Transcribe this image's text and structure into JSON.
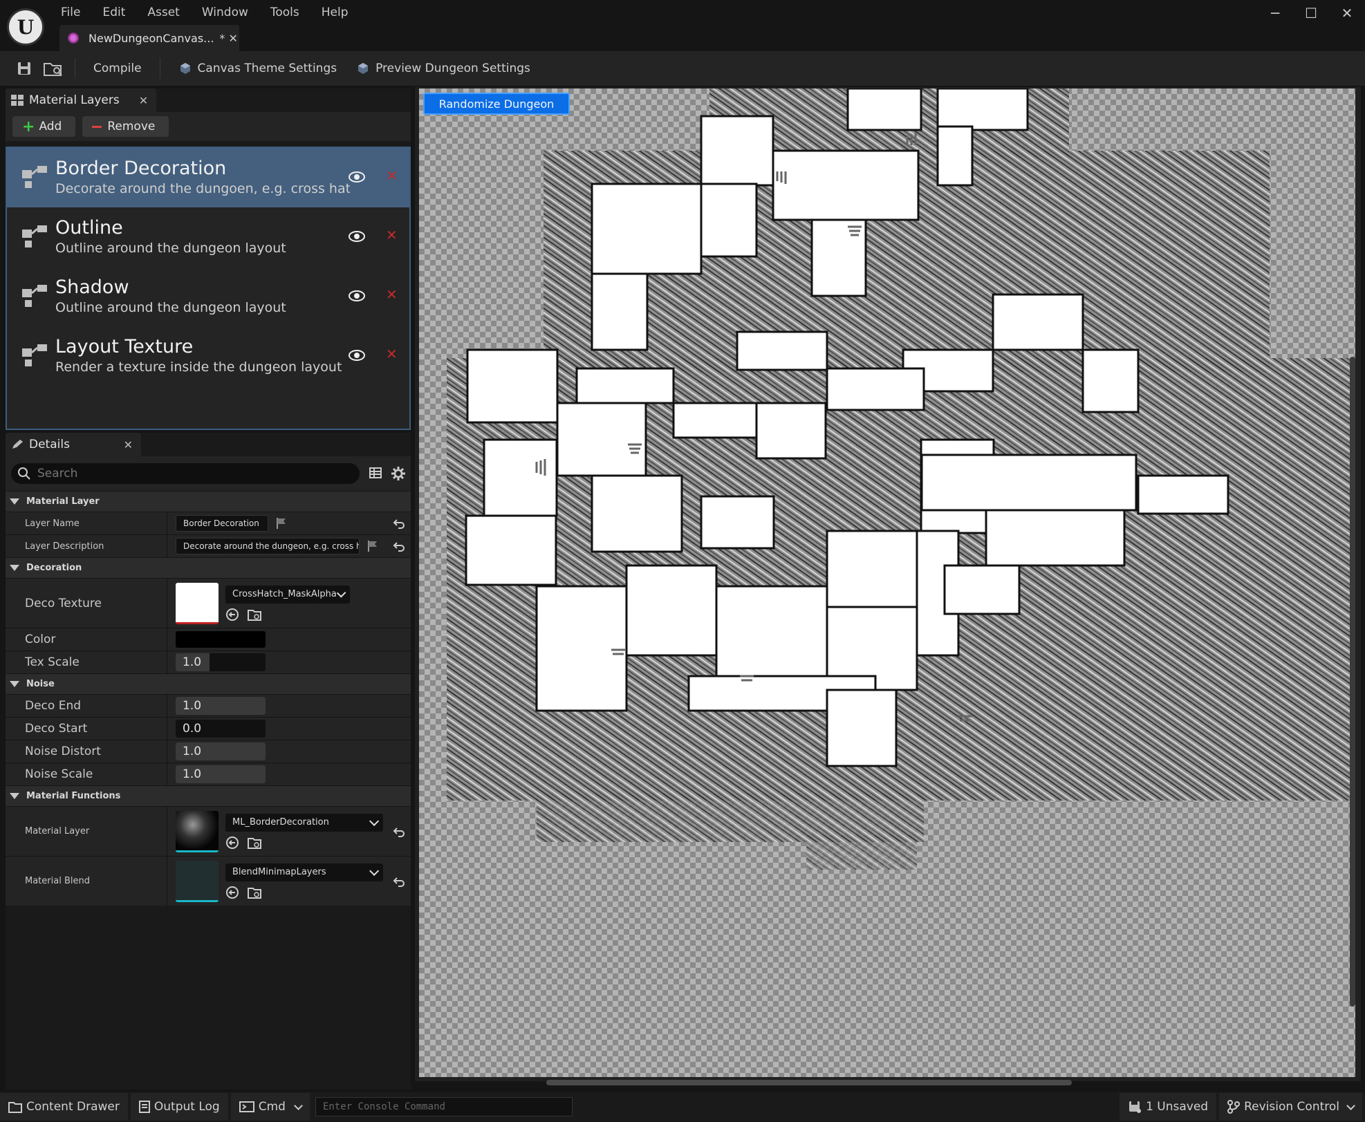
{
  "app": {
    "logo_letter": "U",
    "menu": [
      "File",
      "Edit",
      "Asset",
      "Window",
      "Tools",
      "Help"
    ],
    "doc_tab": "NewDungeonCanvas...",
    "doc_tab_suffix": "* ✕"
  },
  "toolbar": {
    "compile_label": "Compile",
    "theme_label": "Canvas Theme Settings",
    "preview_label": "Preview Dungeon Settings"
  },
  "layers_panel": {
    "tab_label": "Material Layers",
    "add_label": "Add",
    "remove_label": "Remove",
    "layers": [
      {
        "name": "Border Decoration",
        "desc": "Decorate around the dungoen, e.g. cross hatches",
        "selected": true
      },
      {
        "name": "Outline",
        "desc": "Outline around the dungeon layout"
      },
      {
        "name": "Shadow",
        "desc": "Outline around the dungeon layout"
      },
      {
        "name": "Layout  Texture",
        "desc": "Render a texture inside the dungeon layout"
      }
    ]
  },
  "details_panel": {
    "tab_label": "Details",
    "search_placeholder": "Search",
    "categories": {
      "material_layer": "Material Layer",
      "decoration": "Decoration",
      "noise": "Noise",
      "material_functions": "Material Functions"
    },
    "layer_name_label": "Layer Name",
    "layer_name_value": "Border Decoration",
    "layer_desc_label": "Layer Description",
    "layer_desc_value": "Decorate around the dungeon, e.g. cross h",
    "deco_texture_label": "Deco Texture",
    "deco_texture_value": "CrossHatch_MaskAlpha",
    "color_label": "Color",
    "color_value": "#000000",
    "tex_scale_label": "Tex Scale",
    "tex_scale_value": "1.0",
    "deco_end_label": "Deco End",
    "deco_end_value": "1.0",
    "deco_start_label": "Deco Start",
    "deco_start_value": "0.0",
    "noise_distort_label": "Noise Distort",
    "noise_distort_value": "1.0",
    "noise_scale_label": "Noise Scale",
    "noise_scale_value": "1.0",
    "material_layer_label": "Material Layer",
    "material_layer_value": "ML_BorderDecoration",
    "material_blend_label": "Material Blend",
    "material_blend_value": "BlendMinimapLayers"
  },
  "viewport": {
    "randomize_label": "Randomize Dungeon"
  },
  "statusbar": {
    "content_drawer": "Content Drawer",
    "output_log": "Output Log",
    "cmd": "Cmd",
    "console_placeholder": "Enter Console Command",
    "unsaved": "1 Unsaved",
    "revision_control": "Revision Control"
  },
  "colors": {
    "accent_blue": "#0c6ee6",
    "selection": "#44607e",
    "delete_red": "#c42a2a",
    "add_green": "#3fc83f"
  }
}
